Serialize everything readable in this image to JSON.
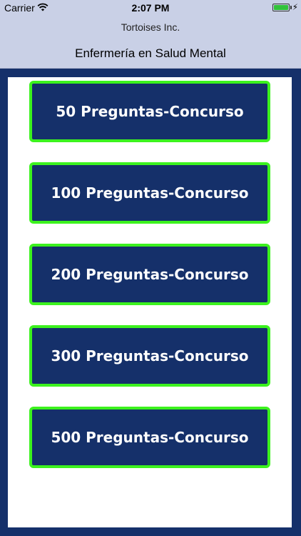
{
  "status_bar": {
    "carrier": "Carrier",
    "time": "2:07 PM",
    "icons": [
      "wifi-icon",
      "battery-icon",
      "charging-bolt-icon"
    ],
    "battery_level": 1.0
  },
  "header": {
    "company": "Tortoises Inc.",
    "title": "Enfermería en Salud Mental"
  },
  "colors": {
    "background": "#15306a",
    "header_bg": "#c9d0e6",
    "button_fill": "#15306a",
    "button_border": "#3cf21e",
    "button_text": "#ffffff"
  },
  "quiz_buttons": [
    {
      "label": "50 Preguntas-Concurso"
    },
    {
      "label": "100 Preguntas-Concurso"
    },
    {
      "label": "200 Preguntas-Concurso"
    },
    {
      "label": "300 Preguntas-Concurso"
    },
    {
      "label": "500 Preguntas-Concurso"
    }
  ]
}
